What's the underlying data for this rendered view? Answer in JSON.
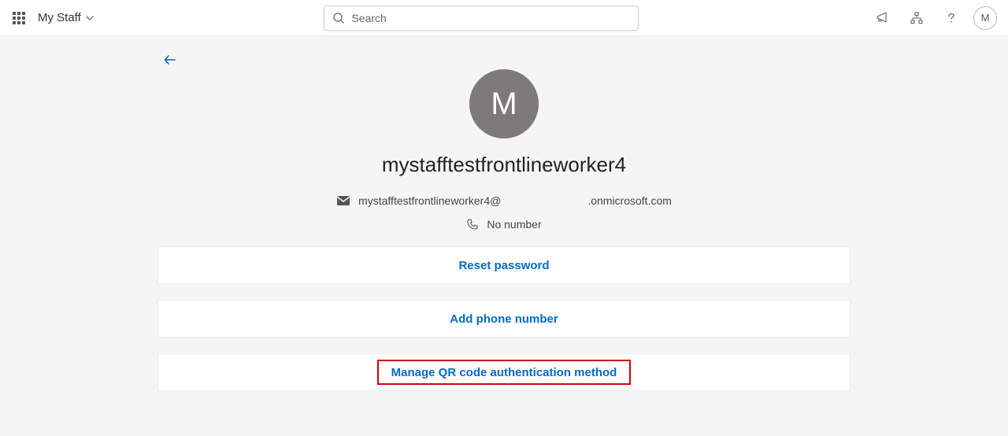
{
  "header": {
    "app_title": "My Staff",
    "search_placeholder": "Search",
    "avatar_initial": "M"
  },
  "profile": {
    "avatar_initial": "M",
    "display_name": "mystafftestfrontlineworker4",
    "email_prefix": "mystafftestfrontlineworker4@",
    "email_suffix": ".onmicrosoft.com",
    "phone_text": "No number"
  },
  "actions": {
    "reset_password": "Reset password",
    "add_phone": "Add phone number",
    "manage_qr": "Manage QR code authentication method"
  }
}
